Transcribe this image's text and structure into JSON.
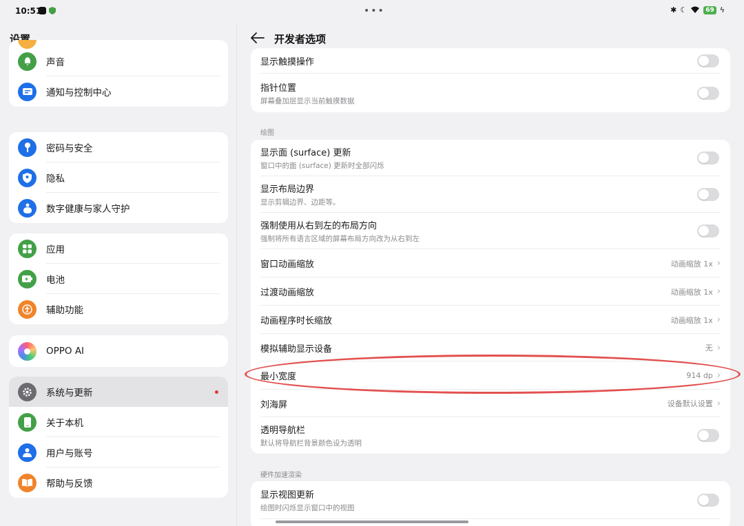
{
  "status": {
    "time": "10:51",
    "battery": "69"
  },
  "left": {
    "title": "设置",
    "groups": [
      {
        "items": [
          {
            "label": "声音"
          },
          {
            "label": "通知与控制中心"
          }
        ]
      },
      {
        "items": [
          {
            "label": "密码与安全"
          },
          {
            "label": "隐私"
          },
          {
            "label": "数字健康与家人守护"
          }
        ]
      },
      {
        "items": [
          {
            "label": "应用"
          },
          {
            "label": "电池"
          },
          {
            "label": "辅助功能"
          }
        ]
      },
      {
        "items": [
          {
            "label": "OPPO AI"
          }
        ]
      },
      {
        "items": [
          {
            "label": "系统与更新"
          },
          {
            "label": "关于本机"
          },
          {
            "label": "用户与账号"
          },
          {
            "label": "帮助与反馈"
          }
        ]
      }
    ]
  },
  "right": {
    "title": "开发者选项",
    "card1": [
      {
        "title": "显示触摸操作"
      },
      {
        "title": "指针位置",
        "subtitle": "屏幕叠加层显示当前触摸数据"
      }
    ],
    "section_drawing": "绘图",
    "card2": [
      {
        "title": "显示面 (surface) 更新",
        "subtitle": "窗口中的面 (surface) 更新时全部闪烁"
      },
      {
        "title": "显示布局边界",
        "subtitle": "显示剪辑边界、边距等。"
      },
      {
        "title": "强制使用从右到左的布局方向",
        "subtitle": "强制将所有语言区域的屏幕布局方向改为从右到左"
      },
      {
        "title": "窗口动画缩放",
        "value": "动画缩放 1x"
      },
      {
        "title": "过渡动画缩放",
        "value": "动画缩放 1x"
      },
      {
        "title": "动画程序时长缩放",
        "value": "动画缩放 1x"
      },
      {
        "title": "模拟辅助显示设备",
        "value": "无"
      },
      {
        "title": "最小宽度",
        "value": "914 dp"
      },
      {
        "title": "刘海屏",
        "value": "设备默认设置"
      },
      {
        "title": "透明导航栏",
        "subtitle": "默认将导航栏背景颜色设为透明"
      }
    ],
    "section_hw": "硬件加速渲染",
    "card3": [
      {
        "title": "显示视图更新",
        "subtitle": "绘图时闪烁显示窗口中的视图"
      }
    ]
  },
  "colors": {
    "accent_highlight": "#e2504f"
  }
}
